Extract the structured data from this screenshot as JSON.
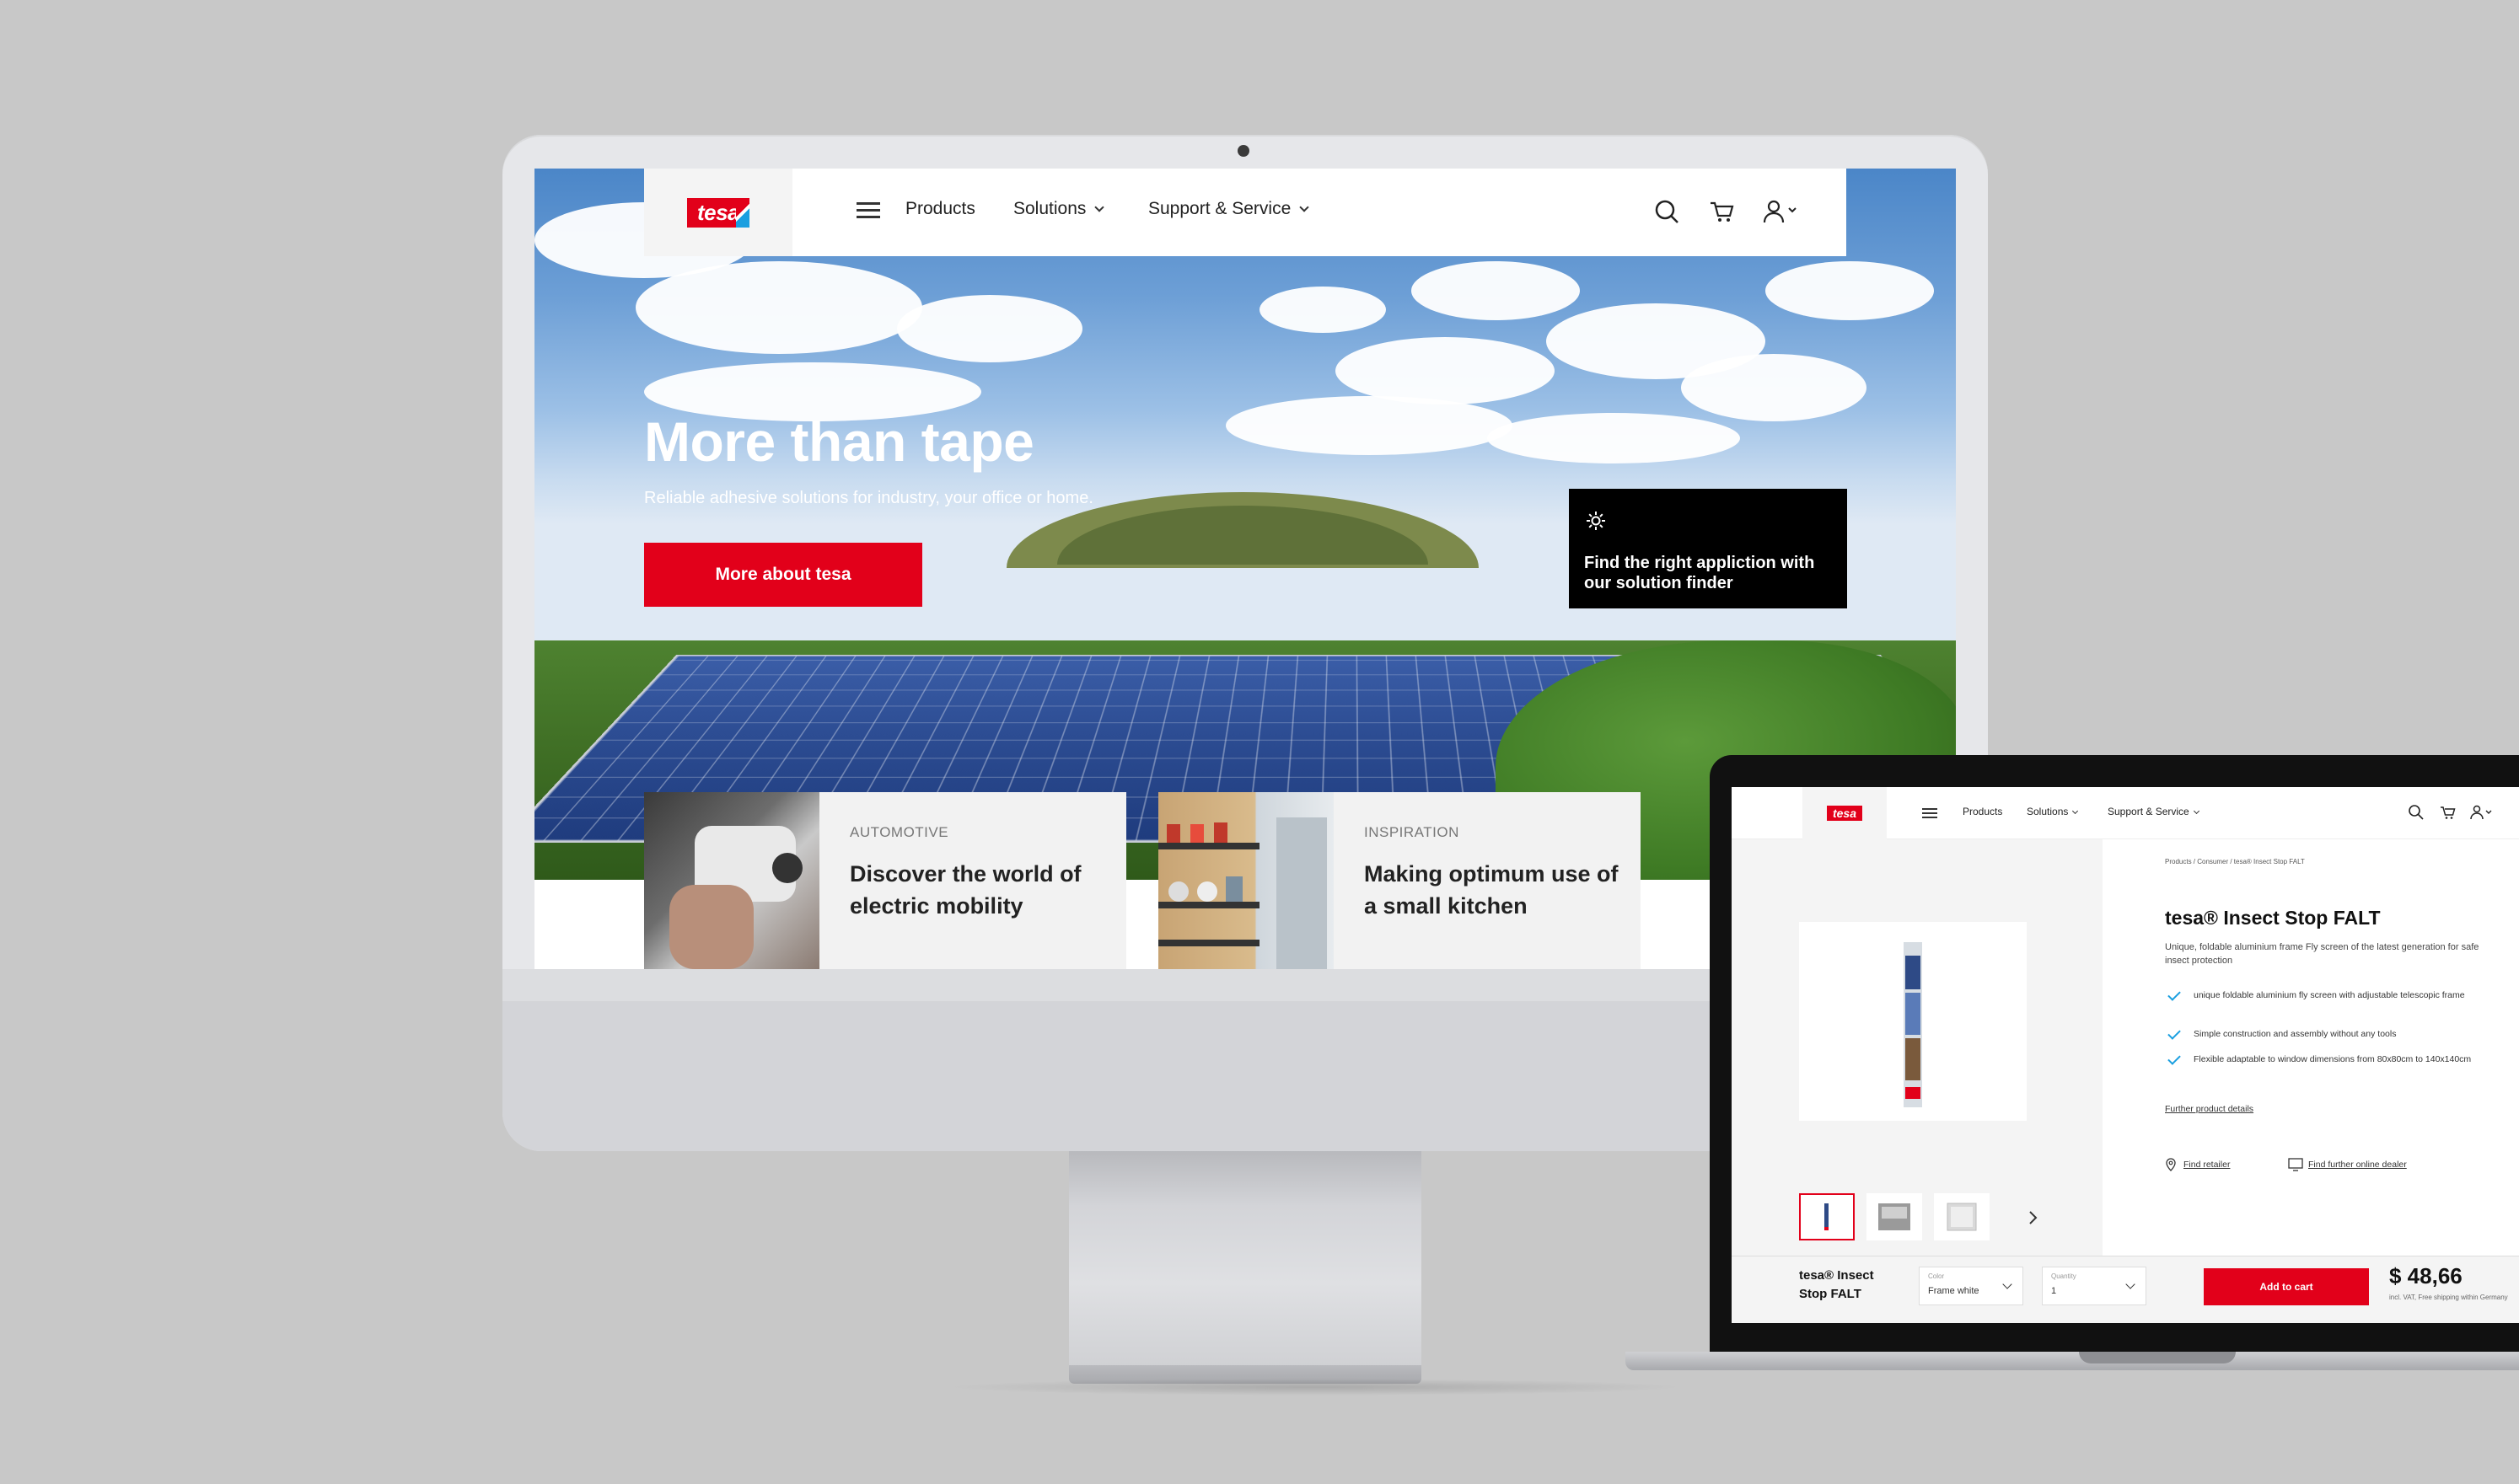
{
  "desktop": {
    "logo": "tesa",
    "nav": {
      "products": "Products",
      "solutions": "Solutions",
      "support": "Support & Service"
    },
    "hero": {
      "title": "More than tape",
      "subtitle": "Reliable adhesive solutions for industry, your office or home.",
      "button": "More about tesa",
      "finder_text": "Find the right appliction with our solution finder"
    },
    "teasers": [
      {
        "category": "AUTOMOTIVE",
        "title": "Discover the world of electric mobility"
      },
      {
        "category": "INSPIRATION",
        "title": "Making optimum use of a small kitchen"
      }
    ]
  },
  "laptop": {
    "logo": "tesa",
    "nav": {
      "products": "Products",
      "solutions": "Solutions",
      "support": "Support & Service"
    },
    "breadcrumb": "Products / Consumer / tesa® Insect Stop FALT",
    "product_title": "tesa® Insect Stop FALT",
    "description": "Unique, foldable aluminium frame Fly screen of the latest generation for safe insect protection",
    "bullets": [
      "unique foldable aluminium fly screen with adjustable telescopic frame",
      "Simple construction and assembly without any tools",
      "Flexible adaptable to window dimensions from 80x80cm to 140x140cm"
    ],
    "further_details": "Further product details",
    "find_retailer": "Find retailer",
    "find_dealer": "Find further online dealer",
    "footer": {
      "product_name": "tesa® Insect Stop FALT",
      "color_label": "Color",
      "color_value": "Frame white",
      "quantity_label": "Quantity",
      "quantity_value": "1",
      "add_to_cart": "Add to cart",
      "price": "$ 48,66",
      "vat_note": "incl. VAT, Free shipping within Germany"
    }
  },
  "colors": {
    "brand_red": "#e2001a",
    "brand_blue": "#1a9fe0",
    "background": "#c8c8c8"
  }
}
